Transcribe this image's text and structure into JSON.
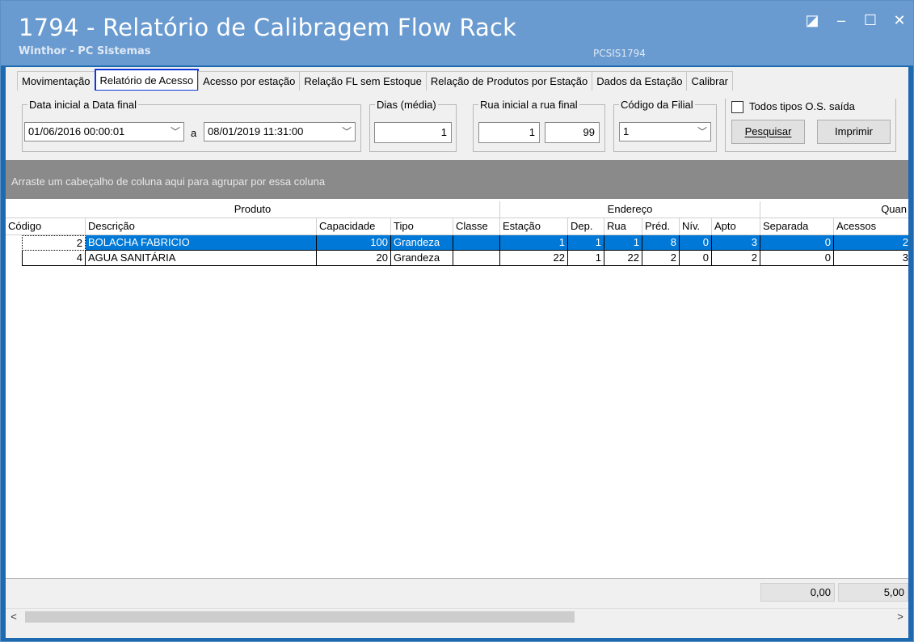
{
  "window": {
    "title": "1794 - Relatório de Calibragem Flow Rack",
    "subtitle": "Winthor - PC Sistemas",
    "code": "PCSIS1794",
    "controls": [
      "◪",
      "‒",
      "☐",
      "✕"
    ]
  },
  "tabs": [
    {
      "label": "Movimentação",
      "active": false
    },
    {
      "label": "Relatório de Acesso",
      "active": true
    },
    {
      "label": "Acesso por estação",
      "active": false
    },
    {
      "label": "Relação FL sem Estoque",
      "active": false
    },
    {
      "label": "Relação de Produtos por Estação",
      "active": false
    },
    {
      "label": "Dados da Estação",
      "active": false
    },
    {
      "label": "Calibrar",
      "active": false
    }
  ],
  "filters": {
    "date_group_label": "Data inicial a Data final",
    "date_start": "01/06/2016 00:00:01",
    "date_sep": "a",
    "date_end": "08/01/2019 11:31:00",
    "dias_label": "Dias (média)",
    "dias_value": "1",
    "rua_label": "Rua inicial a rua final",
    "rua_start": "1",
    "rua_end": "99",
    "filial_label": "Código da Filial",
    "filial_value": "1",
    "todos_label": "Todos tipos O.S. saída",
    "todos_checked": false,
    "pesquisar_label": "Pesquisar",
    "imprimir_label": "Imprimir"
  },
  "group_hint": "Arraste um cabeçalho de coluna aqui para agrupar por essa coluna",
  "bands": {
    "produto": "Produto",
    "endereco": "Endereço",
    "quantidade": "Quan"
  },
  "columns": {
    "codigo": "Código",
    "descricao": "Descrição",
    "capacidade": "Capacidade",
    "tipo": "Tipo",
    "classe": "Classe",
    "estacao": "Estação",
    "dep": "Dep.",
    "rua": "Rua",
    "pred": "Préd.",
    "niv": "Nív.",
    "apto": "Apto",
    "separada": "Separada",
    "acessos": "Acessos"
  },
  "rows": [
    {
      "codigo": "2",
      "descricao": "BOLACHA FABRICIO",
      "capacidade": "100",
      "tipo": "Grandeza",
      "classe": "",
      "estacao": "1",
      "dep": "1",
      "rua": "1",
      "pred": "8",
      "niv": "0",
      "apto": "3",
      "separada": "0",
      "acessos": "2",
      "selected": true
    },
    {
      "codigo": "4",
      "descricao": "AGUA SANITÁRIA",
      "capacidade": "20",
      "tipo": "Grandeza",
      "classe": "",
      "estacao": "22",
      "dep": "1",
      "rua": "22",
      "pred": "2",
      "niv": "0",
      "apto": "2",
      "separada": "0",
      "acessos": "3",
      "selected": false
    }
  ],
  "totals": {
    "separada": "0,00",
    "acessos": "5,00"
  },
  "scrollbar": {
    "left": "<",
    "right": ">"
  }
}
